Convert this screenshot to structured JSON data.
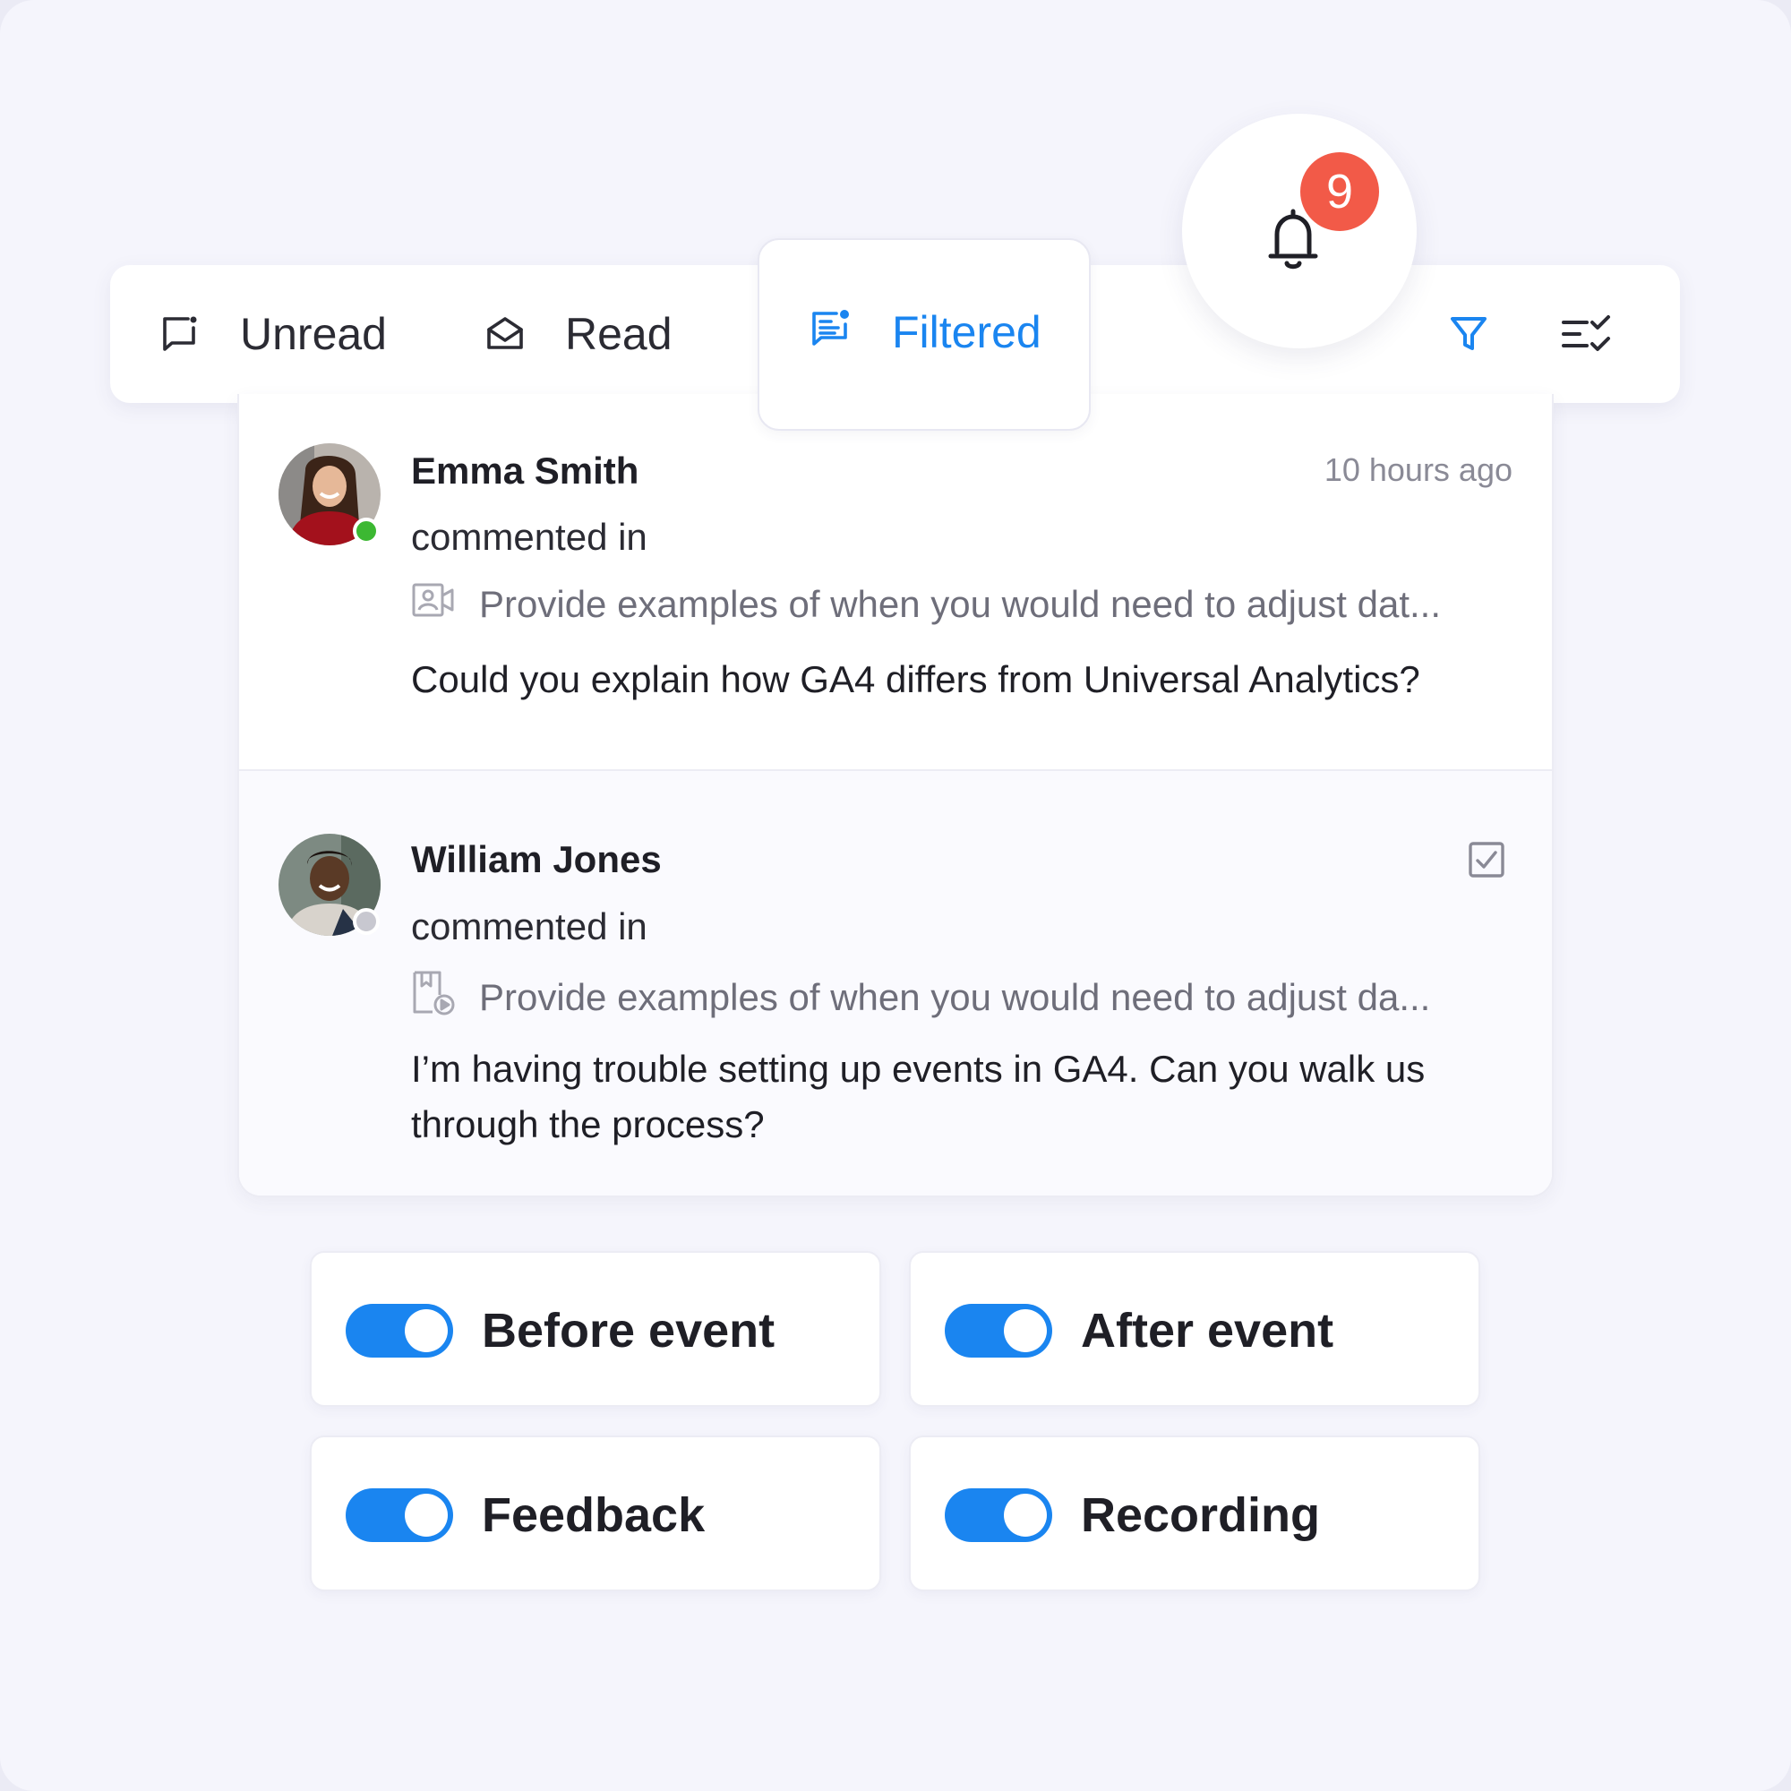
{
  "notifications": {
    "count": "9"
  },
  "tabs": {
    "unread": "Unread",
    "read": "Read",
    "filtered": "Filtered",
    "active": "Filtered"
  },
  "comments": [
    {
      "author": "Emma Smith",
      "status": "online",
      "action": "commented in",
      "reference": "Provide examples of when you would need to adjust dat...",
      "text": "Could you explain how GA4 differs from Universal Analytics?",
      "time": "10 hours ago"
    },
    {
      "author": "William Jones",
      "status": "offline",
      "action": "commented in",
      "reference": "Provide examples of when you would need to adjust da...",
      "text": "I’m having trouble setting up events in GA4. Can you walk us through the process?"
    }
  ],
  "toggles": [
    {
      "label": "Before event",
      "on": true
    },
    {
      "label": "After event",
      "on": true
    },
    {
      "label": "Feedback",
      "on": true
    },
    {
      "label": "Recording",
      "on": true
    }
  ],
  "colors": {
    "accent": "#1a85f0",
    "badge": "#f25a48",
    "online": "#3cb832",
    "offline": "#c8c8d0",
    "background": "#f5f5fc"
  },
  "icons": {
    "unread": "message-dot-icon",
    "read": "envelope-open-icon",
    "filtered": "message-lines-icon",
    "filter": "filter-icon",
    "checklist": "checklist-icon",
    "bell": "bell-icon",
    "video_ref": "video-document-icon",
    "audio_ref": "media-document-icon",
    "mark_read": "checkbox-icon"
  }
}
